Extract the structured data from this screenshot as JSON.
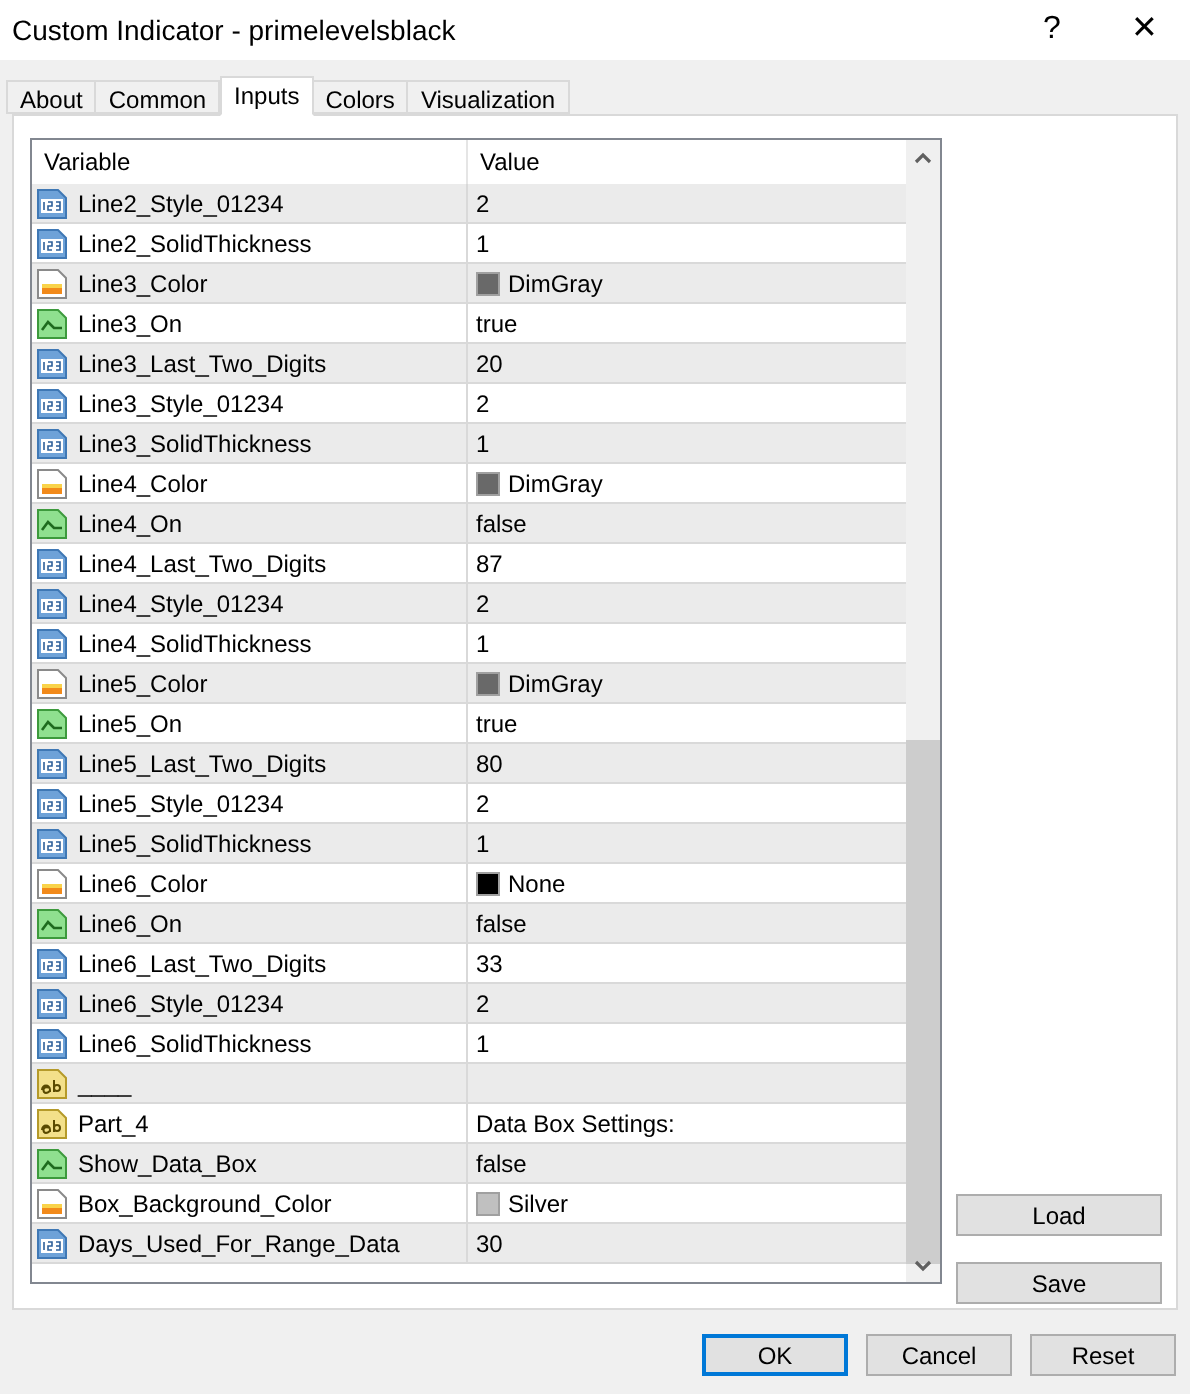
{
  "window": {
    "title": "Custom Indicator - primelevelsblack",
    "help": "?",
    "close": "✕"
  },
  "tabs": [
    {
      "label": "About",
      "selected": false
    },
    {
      "label": "Common",
      "selected": false
    },
    {
      "label": "Inputs",
      "selected": true
    },
    {
      "label": "Colors",
      "selected": false
    },
    {
      "label": "Visualization",
      "selected": false
    }
  ],
  "table": {
    "columns": [
      "Variable",
      "Value"
    ],
    "rows": [
      {
        "kind": "int",
        "variable": "Line2_Style_01234",
        "value": "2"
      },
      {
        "kind": "int",
        "variable": "Line2_SolidThickness",
        "value": "1"
      },
      {
        "kind": "color",
        "variable": "Line3_Color",
        "value": "DimGray",
        "color": "#696969"
      },
      {
        "kind": "bool",
        "variable": "Line3_On",
        "value": "true"
      },
      {
        "kind": "int",
        "variable": "Line3_Last_Two_Digits",
        "value": "20"
      },
      {
        "kind": "int",
        "variable": "Line3_Style_01234",
        "value": "2"
      },
      {
        "kind": "int",
        "variable": "Line3_SolidThickness",
        "value": "1"
      },
      {
        "kind": "color",
        "variable": "Line4_Color",
        "value": "DimGray",
        "color": "#696969"
      },
      {
        "kind": "bool",
        "variable": "Line4_On",
        "value": "false"
      },
      {
        "kind": "int",
        "variable": "Line4_Last_Two_Digits",
        "value": "87"
      },
      {
        "kind": "int",
        "variable": "Line4_Style_01234",
        "value": "2"
      },
      {
        "kind": "int",
        "variable": "Line4_SolidThickness",
        "value": "1"
      },
      {
        "kind": "color",
        "variable": "Line5_Color",
        "value": "DimGray",
        "color": "#696969"
      },
      {
        "kind": "bool",
        "variable": "Line5_On",
        "value": "true"
      },
      {
        "kind": "int",
        "variable": "Line5_Last_Two_Digits",
        "value": "80"
      },
      {
        "kind": "int",
        "variable": "Line5_Style_01234",
        "value": "2"
      },
      {
        "kind": "int",
        "variable": "Line5_SolidThickness",
        "value": "1"
      },
      {
        "kind": "color",
        "variable": "Line6_Color",
        "value": "None",
        "color": "#000000"
      },
      {
        "kind": "bool",
        "variable": "Line6_On",
        "value": "false"
      },
      {
        "kind": "int",
        "variable": "Line6_Last_Two_Digits",
        "value": "33"
      },
      {
        "kind": "int",
        "variable": "Line6_Style_01234",
        "value": "2"
      },
      {
        "kind": "int",
        "variable": "Line6_SolidThickness",
        "value": "1"
      },
      {
        "kind": "string",
        "variable": "____"
      },
      {
        "kind": "string",
        "variable": "Part_4",
        "value": "Data Box Settings:"
      },
      {
        "kind": "bool",
        "variable": "Show_Data_Box",
        "value": "false"
      },
      {
        "kind": "color",
        "variable": "Box_Background_Color",
        "value": "Silver",
        "color": "#c0c0c0"
      },
      {
        "kind": "int",
        "variable": "Days_Used_For_Range_Data",
        "value": "30"
      }
    ]
  },
  "side_buttons": [
    "Load",
    "Save"
  ],
  "buttons": [
    {
      "label": "OK",
      "selected": true
    },
    {
      "label": "Cancel",
      "selected": false
    },
    {
      "label": "Reset",
      "selected": false
    }
  ]
}
